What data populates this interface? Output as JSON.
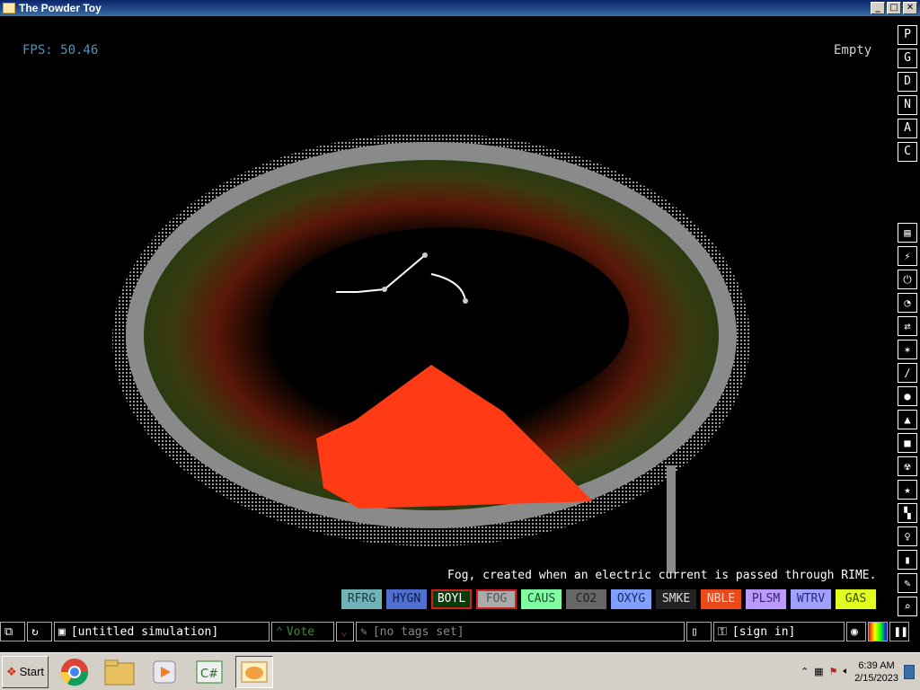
{
  "window": {
    "title": "The Powder Toy",
    "btn_min": "_",
    "btn_max": "□",
    "btn_close": "✕"
  },
  "hud": {
    "fps": "FPS: 50.46",
    "hover_element": "Empty"
  },
  "mode_buttons": [
    "P",
    "G",
    "D",
    "N",
    "A",
    "C"
  ],
  "category_icons": [
    "walls-icon",
    "electronics-icon",
    "powered-icon",
    "sensors-icon",
    "force-icon",
    "explosives-icon",
    "gases-icon",
    "liquids-icon",
    "powders-icon",
    "solids-icon",
    "radioactive-icon",
    "special-icon",
    "life-icon",
    "tools-icon",
    "favorites-icon",
    "decoration-icon",
    "search-icon"
  ],
  "tooltip": "Fog, created when an electric current is passed through RIME.",
  "elements": [
    {
      "label": "RFRG",
      "bg": "#6fb3b8",
      "fg": "#1a3a3c"
    },
    {
      "label": "HYGN",
      "bg": "#4f6fd0",
      "fg": "#0a1a4a"
    },
    {
      "label": "BOYL",
      "bg": "#0b3a0b",
      "fg": "#ffffff"
    },
    {
      "label": "FOG",
      "bg": "#aaaaaa",
      "fg": "#555555"
    },
    {
      "label": "CAUS",
      "bg": "#80ffa0",
      "fg": "#1a4a2a"
    },
    {
      "label": "CO2",
      "bg": "#666666",
      "fg": "#222222"
    },
    {
      "label": "OXYG",
      "bg": "#80a0ff",
      "fg": "#1a2a5a"
    },
    {
      "label": "SMKE",
      "bg": "#222222",
      "fg": "#dddddd"
    },
    {
      "label": "NBLE",
      "bg": "#eb4917",
      "fg": "#ffd0c0"
    },
    {
      "label": "PLSM",
      "bg": "#bb99ff",
      "fg": "#3a2a6a"
    },
    {
      "label": "WTRV",
      "bg": "#a0a0ff",
      "fg": "#2a2a7a"
    },
    {
      "label": "GAS",
      "bg": "#e0ff20",
      "fg": "#3a4a00"
    }
  ],
  "simbar": {
    "save_name": "[untitled simulation]",
    "vote": "Vote",
    "tags": "[no tags set]",
    "sign_in": "[sign in]"
  },
  "taskbar": {
    "start": "Start",
    "time": "6:39 AM",
    "date": "2/15/2023"
  }
}
